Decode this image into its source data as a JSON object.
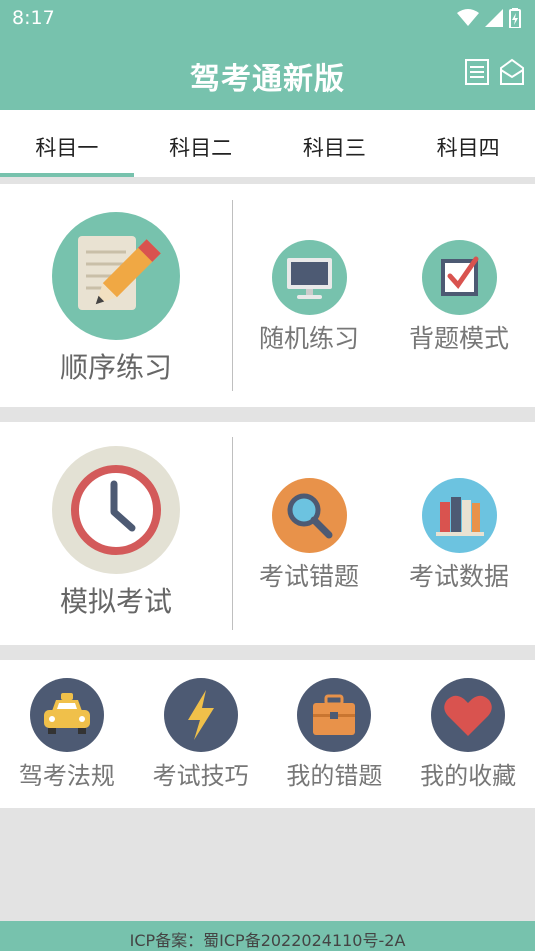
{
  "status_bar": {
    "time": "8:17"
  },
  "header": {
    "title": "驾考通新版"
  },
  "tabs": [
    {
      "label": "科目一"
    },
    {
      "label": "科目二"
    },
    {
      "label": "科目三"
    },
    {
      "label": "科目四"
    }
  ],
  "section1": {
    "main": {
      "label": "顺序练习",
      "icon": "notepad-pencil-icon"
    },
    "items": [
      {
        "label": "随机练习",
        "icon": "monitor-icon"
      },
      {
        "label": "背题模式",
        "icon": "checkbox-icon"
      }
    ]
  },
  "section2": {
    "main": {
      "label": "模拟考试",
      "icon": "clock-icon"
    },
    "items": [
      {
        "label": "考试错题",
        "icon": "magnifier-icon"
      },
      {
        "label": "考试数据",
        "icon": "books-icon"
      }
    ]
  },
  "section3": {
    "items": [
      {
        "label": "驾考法规",
        "icon": "taxi-icon"
      },
      {
        "label": "考试技巧",
        "icon": "lightning-icon"
      },
      {
        "label": "我的错题",
        "icon": "briefcase-icon"
      },
      {
        "label": "我的收藏",
        "icon": "heart-icon"
      }
    ]
  },
  "footer": {
    "text": "ICP备案：蜀ICP备2022024110号-2A"
  },
  "colors": {
    "accent": "#77c2ad",
    "dark_circle": "#4d5a73",
    "orange": "#e8924a"
  }
}
